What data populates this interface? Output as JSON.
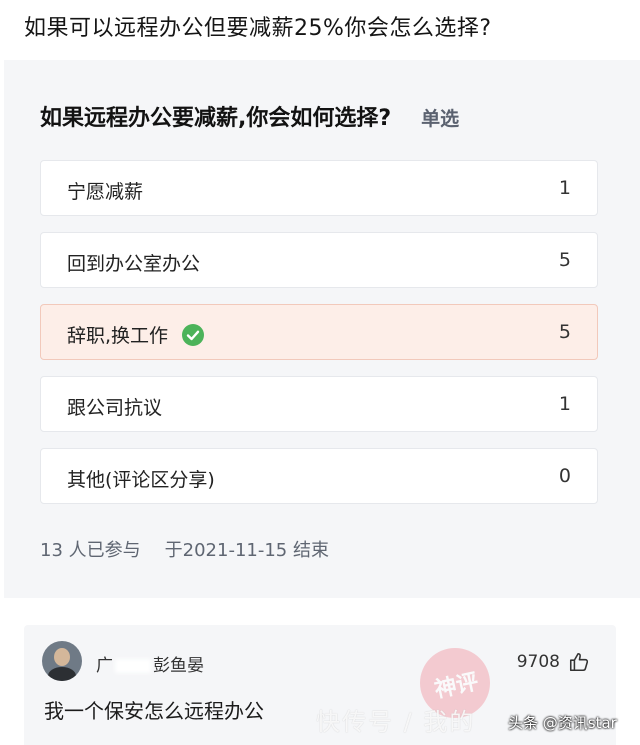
{
  "question": {
    "title": "如果可以远程办公但要减薪25%你会怎么选择?"
  },
  "poll": {
    "title": "如果远程办公要减薪,你会如何选择?",
    "type": "单选",
    "options": [
      {
        "label": "宁愿减薪",
        "count": "1",
        "selected": false
      },
      {
        "label": "回到办公室办公",
        "count": "5",
        "selected": false
      },
      {
        "label": "辞职,换工作",
        "count": "5",
        "selected": true
      },
      {
        "label": "跟公司抗议",
        "count": "1",
        "selected": false
      },
      {
        "label": "其他(评论区分享)",
        "count": "0",
        "selected": false
      }
    ],
    "participants": "13 人已参与",
    "ended": "于2021-11-15 结束",
    "check_icon": "check-circle-icon",
    "check_color": "#4cb35a",
    "selected_bg": "#fdeee8"
  },
  "comment": {
    "user_name_start": "广",
    "user_name_end": "彭鱼晏",
    "likes": "9708",
    "like_icon": "thumbs-up-icon",
    "text": "我一个保安怎么远程办公"
  },
  "overlay": {
    "stamp_text": "神评",
    "watermark": "快传号 / 我的",
    "source": "头条 @资讯star"
  }
}
